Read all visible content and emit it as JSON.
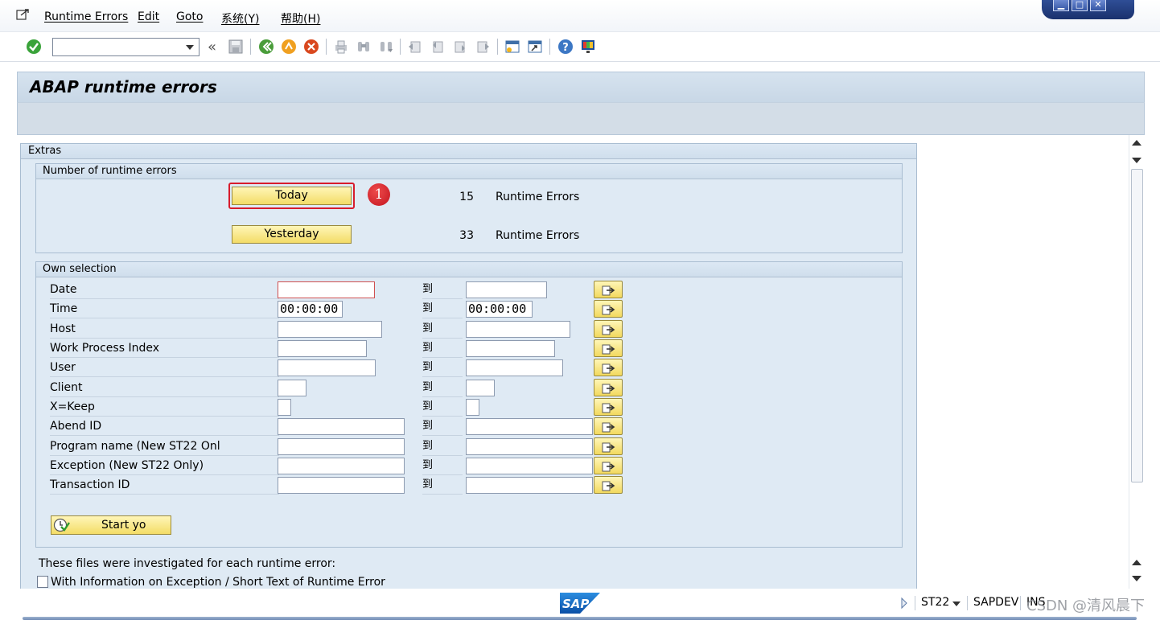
{
  "menubar": {
    "items": [
      "Runtime Errors",
      "Edit",
      "Goto",
      "系统(Y)",
      "帮助(H)"
    ],
    "window_controls": [
      "minimize-icon",
      "maximize-icon",
      "close-icon"
    ]
  },
  "toolbar": {
    "command_field_value": "",
    "back_symbol": "«",
    "icons": [
      "check-icon",
      "save-icon",
      "back-icon",
      "exit-icon",
      "cancel-icon",
      "print-icon",
      "find-icon",
      "find-next-icon",
      "first-page-icon",
      "previous-page-icon",
      "next-page-icon",
      "last-page-icon",
      "create-session-icon",
      "shortcut-icon",
      "help-icon",
      "customize-layout-icon"
    ]
  },
  "title": "ABAP runtime errors",
  "extras": {
    "title": "Extras",
    "number_group": {
      "title": "Number of runtime errors",
      "today_label": "Today",
      "today_count": "15",
      "today_count_label": "Runtime Errors",
      "yesterday_label": "Yesterday",
      "yesterday_count": "33",
      "yesterday_count_label": "Runtime Errors",
      "badge": "1"
    },
    "own_selection": {
      "title": "Own selection",
      "to_label": "到",
      "rows": [
        {
          "label": "Date",
          "from": "",
          "to": ""
        },
        {
          "label": "Time",
          "from": "00:00:00",
          "to": "00:00:00"
        },
        {
          "label": "Host",
          "from": "",
          "to": ""
        },
        {
          "label": "Work Process Index",
          "from": "",
          "to": ""
        },
        {
          "label": "User",
          "from": "",
          "to": ""
        },
        {
          "label": "Client",
          "from": "",
          "to": ""
        },
        {
          "label": "X=Keep",
          "from": "",
          "to": ""
        },
        {
          "label": "Abend ID",
          "from": "",
          "to": ""
        },
        {
          "label": "Program name (New ST22 Onl",
          "from": "",
          "to": ""
        },
        {
          "label": "Exception (New ST22 Only)",
          "from": "",
          "to": ""
        },
        {
          "label": "Transaction ID",
          "from": "",
          "to": ""
        }
      ],
      "start_label": "Start yo"
    },
    "info_text": "These files were investigated for each runtime error:",
    "checkbox_label": "With Information on Exception / Short Text of Runtime Error"
  },
  "statusbar": {
    "transaction": "ST22",
    "system": "SAPDEV",
    "mode": "INS",
    "watermark": "CSDN @清风晨下"
  },
  "colors": {
    "button_yellow": "#f3dc66",
    "panel_blue": "#dfeaf4",
    "title_blue": "#c8d7e6",
    "highlight_red": "#d81c2c"
  }
}
